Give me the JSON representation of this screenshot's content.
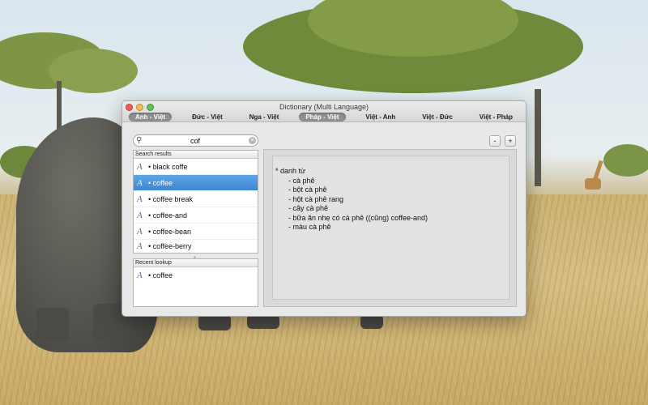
{
  "window": {
    "title": "Dictionary (Multi Language)"
  },
  "languages": [
    {
      "label": "Anh - Việt",
      "active": true
    },
    {
      "label": "Đức - Việt",
      "active": false
    },
    {
      "label": "Nga - Việt",
      "active": false
    },
    {
      "label": "Pháp - Việt",
      "active": true
    },
    {
      "label": "Việt - Anh",
      "active": false
    },
    {
      "label": "Việt - Đức",
      "active": false
    },
    {
      "label": "Việt - Pháp",
      "active": false
    }
  ],
  "search": {
    "value": "cof",
    "icon": "search-icon",
    "clear_icon": "clear-icon"
  },
  "zoom": {
    "minus": "-",
    "plus": "+"
  },
  "search_results": {
    "header": "Search results",
    "items": [
      {
        "text": "• black coffe",
        "selected": false
      },
      {
        "text": "• coffee",
        "selected": true
      },
      {
        "text": "• coffee break",
        "selected": false
      },
      {
        "text": "• coffee-and",
        "selected": false
      },
      {
        "text": "• coffee-bean",
        "selected": false
      },
      {
        "text": "• coffee-berry",
        "selected": false
      }
    ]
  },
  "recent_lookup": {
    "header": "Recent lookup",
    "items": [
      {
        "text": "• coffee"
      }
    ]
  },
  "word_glyph": "A",
  "definition": {
    "part_of_speech": "* danh từ",
    "senses": [
      "- cà phê",
      "- bột cà phê",
      "- hột cà phê rang",
      "- cây cà phê",
      "- bữa ăn nhẹ có cà phê ((cũng) coffee-and)",
      "- màu cà phê"
    ]
  }
}
